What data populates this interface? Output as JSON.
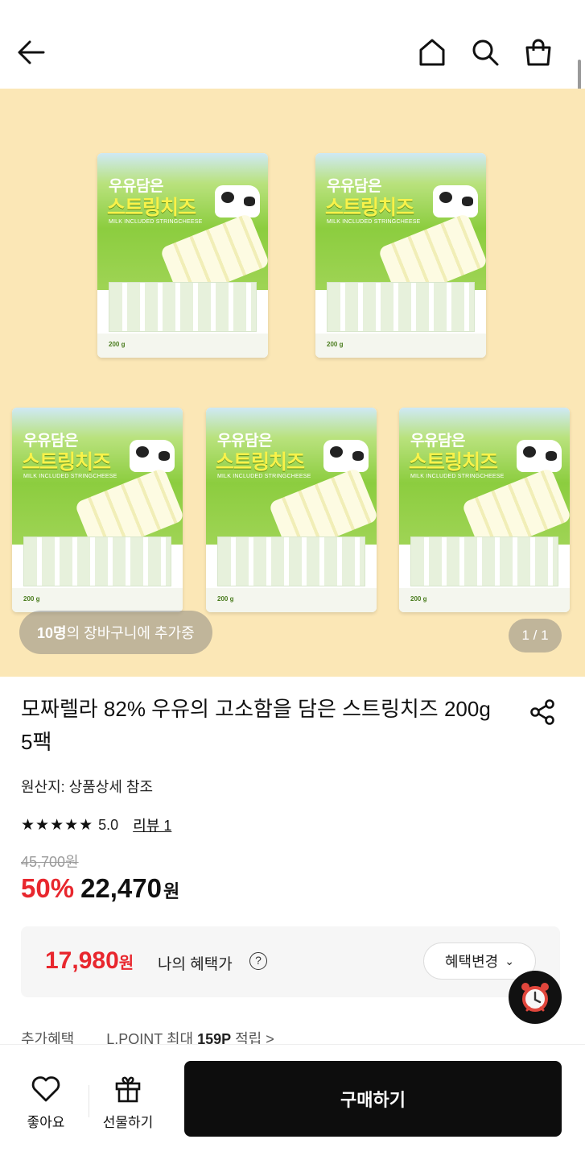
{
  "header": {
    "back_icon": "arrow-left-icon",
    "home_icon": "home-icon",
    "search_icon": "search-icon",
    "cart_icon": "shopping-bag-icon"
  },
  "hero": {
    "pack_text_1": "우유담은",
    "pack_text_2": "스트링치즈",
    "pack_text_3": "MILK INCLUDED STRINGCHEESE",
    "pack_weight": "200 g",
    "cart_count": "10명",
    "cart_suffix": "의 장바구니에 추가중",
    "page_indicator": "1 / 1",
    "background_color": "#fbe7b6"
  },
  "product": {
    "title": "모짜렐라 82% 우유의 고소함을 담은 스트링치즈 200g 5팩",
    "origin": "원산지: 상품상세 참조",
    "stars": "★★★★★",
    "rating": "5.0",
    "review_label": "리뷰 1",
    "original_price": "45,700원",
    "discount_rate": "50%",
    "price": "22,470",
    "price_unit": "원"
  },
  "benefit": {
    "price": "17,980",
    "price_unit": "원",
    "label": "나의 혜택가",
    "help_symbol": "?",
    "change_label": "혜택변경",
    "accent_color": "#e8272e"
  },
  "extra": {
    "label": "추가혜택",
    "text_prefix": "L.POINT 최대 ",
    "points": "159P",
    "text_suffix": " 적립 >"
  },
  "bottom_bar": {
    "like_label": "좋아요",
    "gift_label": "선물하기",
    "buy_label": "구매하기"
  }
}
